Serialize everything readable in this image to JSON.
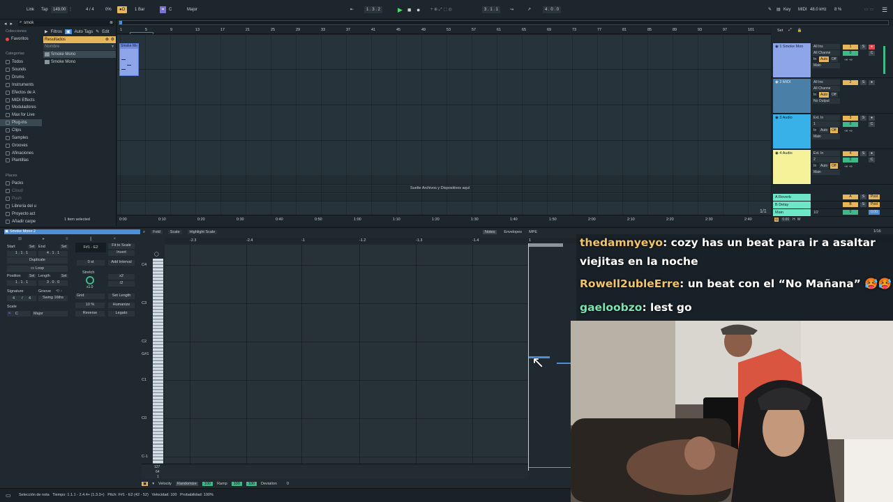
{
  "transport": {
    "link": "Link",
    "tap": "Tap",
    "tempo": "149.00",
    "signature": "4 / 4",
    "cpu_load": "0%",
    "quantize": "1 Bar",
    "key": "C",
    "scale": "Major",
    "position": "1 . 3 . 2",
    "loop_start": "3 . 1 . 1",
    "loop_length": "4 . 0 . 0",
    "key_label": "Key",
    "midi_label": "MIDI",
    "sample_rate": "48.0 kHz",
    "cpu": "8 %"
  },
  "browser": {
    "search": "smok",
    "filters": "Filtros",
    "auto_tags": "Auto Tags",
    "edit": "Edit",
    "results": "Resultados",
    "column_name": "Nombre",
    "collections_label": "Colecciones",
    "favorites": "Favoritos",
    "categories_label": "Categorías",
    "categories": [
      "Todos",
      "Sounds",
      "Drums",
      "Instruments",
      "Efectos de A",
      "MIDI Effects",
      "Moduladores",
      "Max for Live",
      "Plug-ins",
      "Clips",
      "Samples",
      "Grooves",
      "Afinaciones",
      "Plantillas"
    ],
    "places_label": "Places",
    "places": [
      "Packs",
      "Cloud",
      "Push",
      "Librería del u",
      "Proyecto act",
      "Añadir carpe"
    ],
    "items": [
      "Smoke Mono",
      "Smoke Mono"
    ],
    "selected_count": "1 item selected"
  },
  "arrangement": {
    "bar_numbers": [
      "1",
      "5",
      "9",
      "13",
      "17",
      "21",
      "25",
      "29",
      "33",
      "37",
      "41",
      "45",
      "49",
      "53",
      "57",
      "61",
      "65",
      "69",
      "73",
      "77",
      "81",
      "85",
      "89",
      "93",
      "97",
      "101"
    ],
    "time_labels": [
      "0:00",
      "0:10",
      "0:20",
      "0:30",
      "0:40",
      "0:50",
      "1:00",
      "1:10",
      "1:20",
      "1:30",
      "1:40",
      "1:50",
      "2:00",
      "2:10",
      "2:20",
      "2:30",
      "2:40"
    ],
    "clip_label": "Smoke Mo",
    "drop_hint": "Suelte Archivos y Dispositivos aquí",
    "page_indicator": "1/1",
    "set_label": "Set"
  },
  "mixer": {
    "tracks": [
      {
        "name": "1 Smoke Mon",
        "color": "#8fa5ea",
        "input": "All Ins",
        "channel": "All Channe",
        "monitor": [
          "In",
          "Auto",
          "Off"
        ],
        "output": "Main",
        "num": "1",
        "vol": "0",
        "pan": "C",
        "sends": "-∞  -∞"
      },
      {
        "name": "2 MIDI",
        "color": "#4a7fa8",
        "input": "All Ins",
        "channel": "All Channe",
        "monitor": [
          "In",
          "Auto",
          "Off"
        ],
        "output": "No Output",
        "num": "2",
        "vol": "",
        "pan": "",
        "sends": ""
      },
      {
        "name": "3 Audio",
        "color": "#38b0e8",
        "input": "Ext. In",
        "channel": "1",
        "monitor": [
          "In",
          "Auto",
          "Off"
        ],
        "output": "Main",
        "num": "3",
        "vol": "0",
        "pan": "C",
        "sends": "-∞  -∞"
      },
      {
        "name": "4 Audio",
        "color": "#f5f29a",
        "input": "Ext. In",
        "channel": "2",
        "monitor": [
          "In",
          "Auto",
          "Off"
        ],
        "output": "Main",
        "num": "4",
        "vol": "0",
        "pan": "C",
        "sends": "-∞  -∞"
      }
    ],
    "returns": [
      {
        "name": "A Reverb",
        "letter": "A",
        "color": "#6ee6c8"
      },
      {
        "name": "B Delay",
        "letter": "B",
        "color": "#6ee6c8"
      },
      {
        "name": "Main",
        "letter": "",
        "color": "#6ee6c8"
      }
    ],
    "main_split": "1/2",
    "main_vol": "0",
    "main_db": "0.00",
    "post": "Post"
  },
  "clip_view": {
    "clip_name": "Smoke Mono 2",
    "start_label": "Start",
    "start_value": "1 . 1 . 1",
    "end_label": "End",
    "end_value": "4 . 1 . 1",
    "set": "Set",
    "duplicate": "Duplicate",
    "loop": "Loop",
    "position_label": "Position",
    "position_value": "1 . 1 . 1",
    "length_label": "Length",
    "length_value": "3 . 0 . 0",
    "signature_label": "Signature",
    "sig_num": "4",
    "sig_den": "4",
    "groove_label": "Groove",
    "groove_value": "Swing 16ths",
    "scale_label": "Scale",
    "scale_key": "C",
    "scale_name": "Major",
    "note_range": "F#1 - E2",
    "fit_to_scale": "Fit to Scale",
    "invert": "Invert",
    "octave_value": "0 st",
    "add_interval": "Add Interval",
    "stretch_label": "Stretch",
    "stretch_value": "x1.0",
    "times2": "x2",
    "div2": "/2",
    "grid_label": "Grid",
    "set_length": "Set Length",
    "humanize_pct": "10 %",
    "humanize": "Humanize",
    "reverse": "Reverse",
    "legato": "Legato"
  },
  "editor": {
    "fold": "Fold",
    "scale": "Scale",
    "highlight_scale": "Highlight Scale",
    "tabs": [
      "Notes",
      "Envelopes",
      "MPE"
    ],
    "zoom": "1/16",
    "ruler": [
      "-2.3",
      "-2.4",
      "-1",
      "-1.2",
      "-1.3",
      "-1.4",
      "1"
    ],
    "pitch_labels": [
      "C4",
      "C3",
      "C2",
      "G#1",
      "C1",
      "C0",
      "C-1"
    ],
    "velocity_max": "127",
    "velocity_mid": "64",
    "velocity_min": "1",
    "lane_velocity": "Velocity",
    "randomize": "Randomize",
    "rand_value": "100",
    "ramp": "Ramp",
    "ramp_a": "100",
    "ramp_b": "100",
    "deviation": "Deviation",
    "deviation_value": "0"
  },
  "status_bar": {
    "text": "Selección de nota   Tiempo: 1.1.1 - 2.4.4+ (1.3.3+)   Pitch: F#1 - E2 (42 - 52)   Velocidad: 100   Probabilidad: 100%"
  },
  "chat": [
    {
      "user": "thedamnyeyo",
      "msg": ": cozy has un beat para ir a asaltar"
    },
    {
      "user": "",
      "msg": "viejitas en la noche"
    },
    {
      "user": "Rowell2ubleErre",
      "msg": ": un beat con el “No Mañana” 🥵🥵"
    },
    {
      "user": "gaeloobzo",
      "msg": ": lest go"
    }
  ],
  "colors": {
    "accent": "#f2c36b",
    "selected": "#e6b65c",
    "loop": "#4a8fd8",
    "return": "#6ee6c8"
  }
}
